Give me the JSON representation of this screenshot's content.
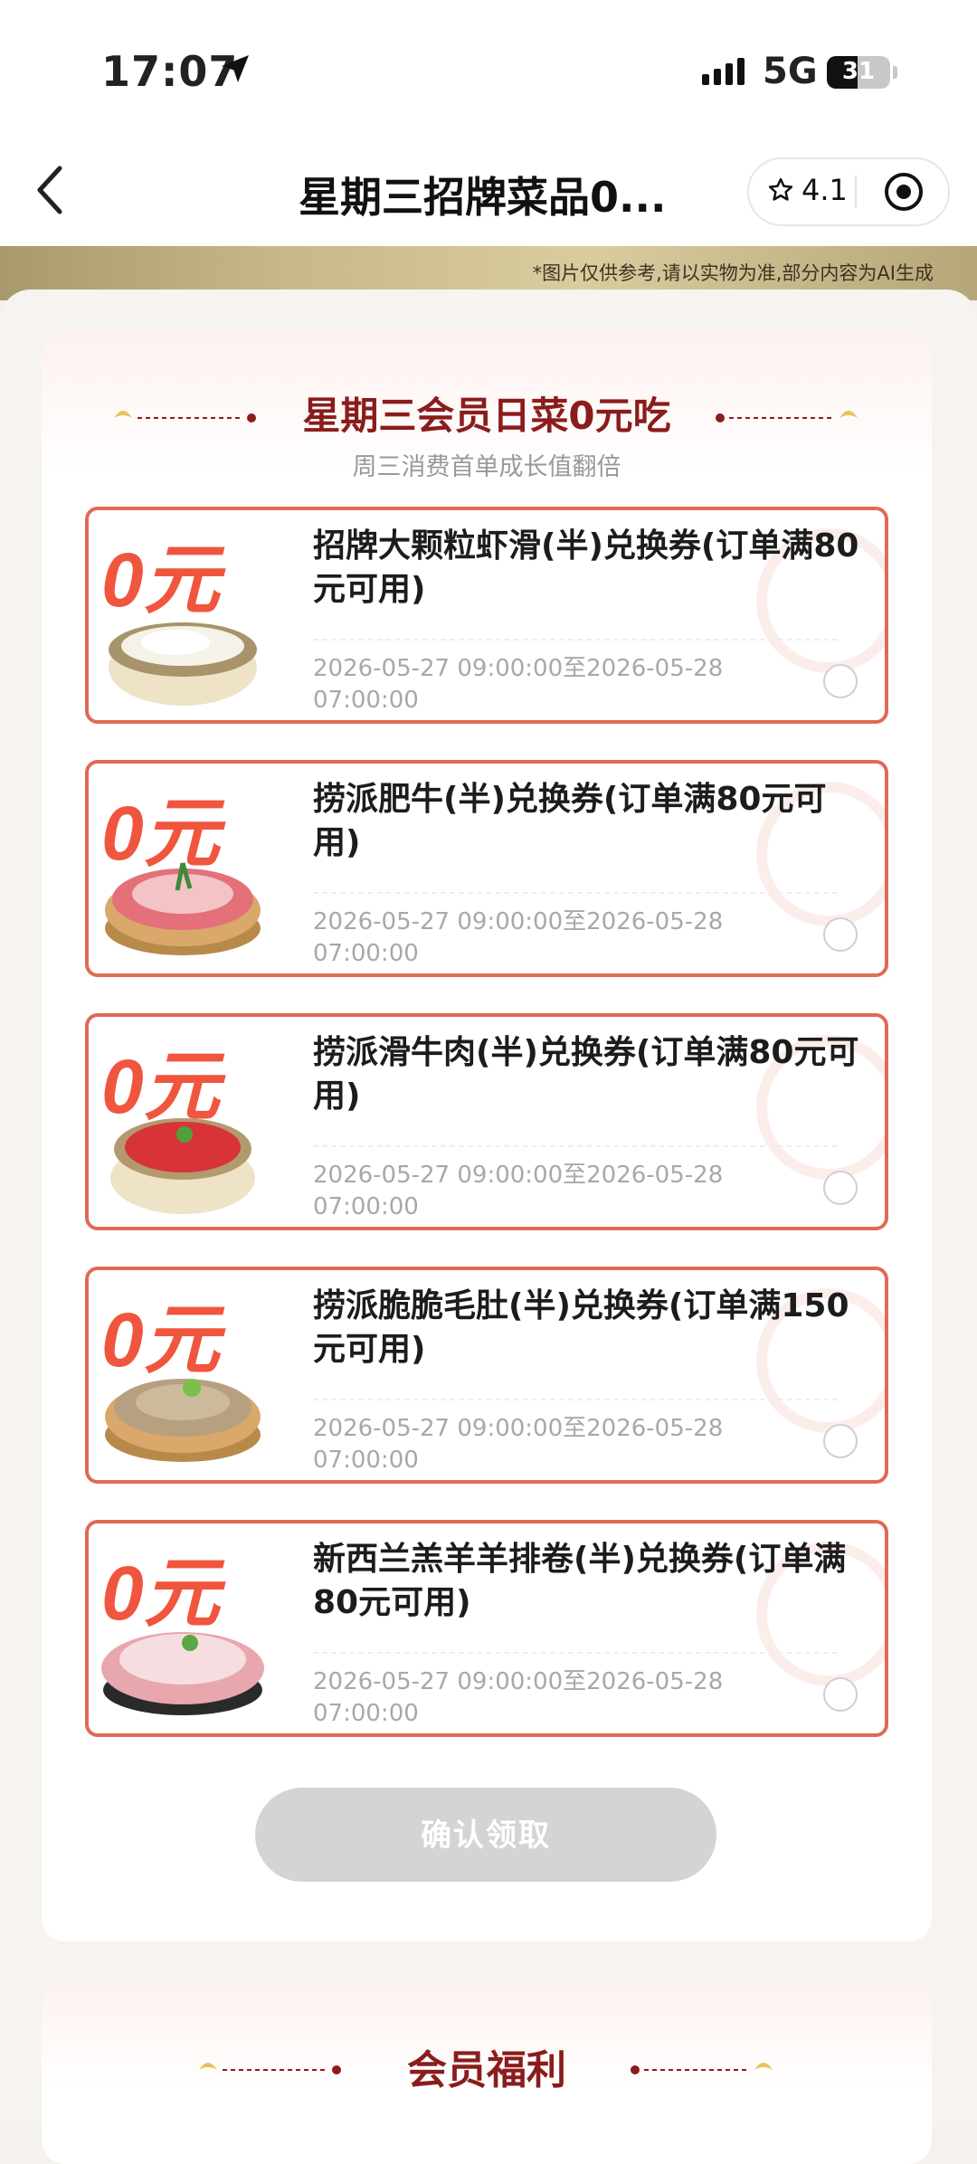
{
  "status_bar": {
    "time": "17:07",
    "network": "5G",
    "battery": "31"
  },
  "nav": {
    "title": "星期三招牌菜品0...",
    "rating": "4.1"
  },
  "banner": {
    "disclaimer": "*图片仅供参考,请以实物为准,部分内容为AI生成"
  },
  "section": {
    "title": "星期三会员日菜0元吃",
    "subtitle": "周三消费首单成长值翻倍"
  },
  "coupons": [
    {
      "name": "招牌大颗粒虾滑(半)兑换券(订单满80元可用)",
      "validity": "2026-05-27 09:00:00至2026-05-28 07:00:00",
      "badge": "0元",
      "dish": "shrimp-paste"
    },
    {
      "name": "捞派肥牛(半)兑换券(订单满80元可用)",
      "validity": "2026-05-27 09:00:00至2026-05-28 07:00:00",
      "badge": "0元",
      "dish": "beef-slices"
    },
    {
      "name": "捞派滑牛肉(半)兑换券(订单满80元可用)",
      "validity": "2026-05-27 09:00:00至2026-05-28 07:00:00",
      "badge": "0元",
      "dish": "minced-beef"
    },
    {
      "name": "捞派脆脆毛肚(半)兑换券(订单满150元可用)",
      "validity": "2026-05-27 09:00:00至2026-05-28 07:00:00",
      "badge": "0元",
      "dish": "tripe"
    },
    {
      "name": "新西兰羔羊羊排卷(半)兑换券(订单满80元可用)",
      "validity": "2026-05-27 09:00:00至2026-05-28 07:00:00",
      "badge": "0元",
      "dish": "lamb-rolls"
    }
  ],
  "confirm_label": "确认领取",
  "section2": {
    "title": "会员福利"
  },
  "colors": {
    "accent": "#e06a55",
    "title_red": "#8b1c1c",
    "disabled_button": "#d4d4d4"
  }
}
